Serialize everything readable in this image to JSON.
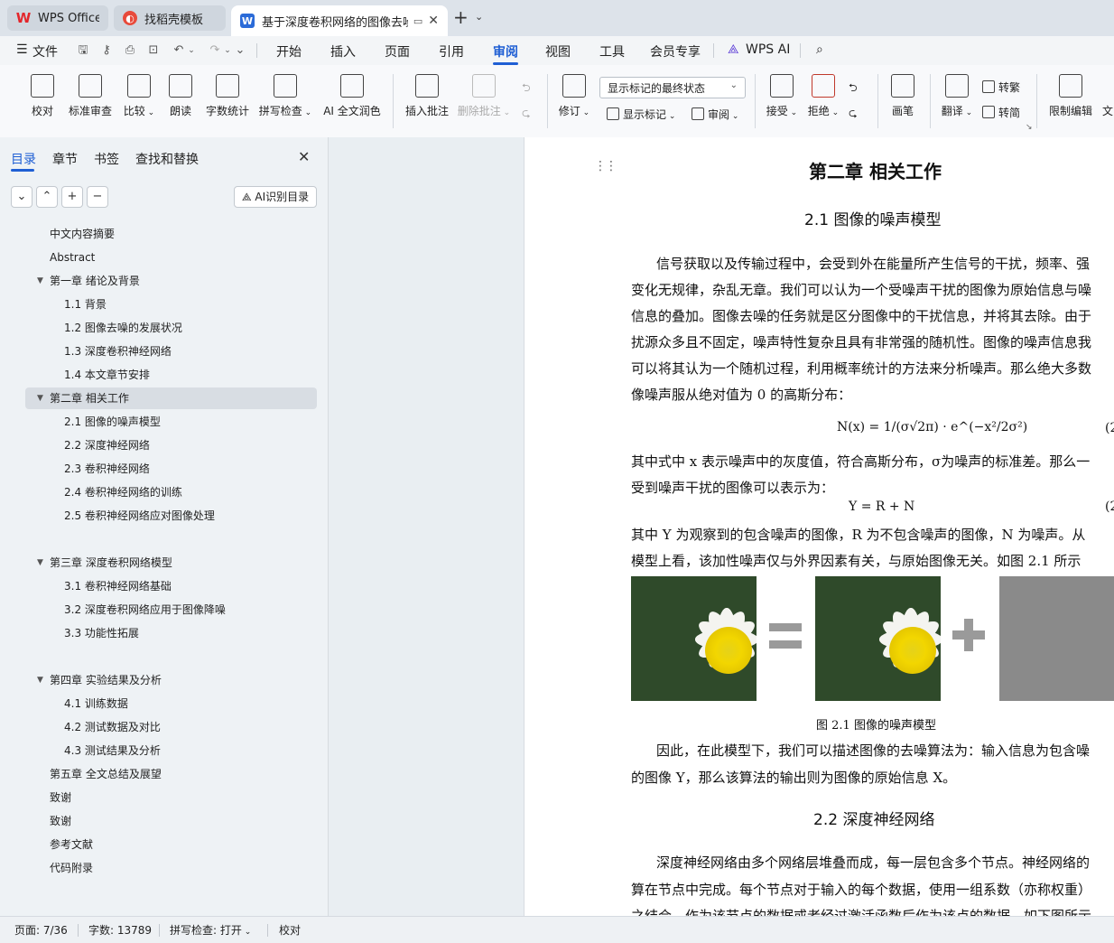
{
  "titlebar": {
    "tabs": [
      {
        "label": "WPS Office"
      },
      {
        "label": "找稻壳模板"
      },
      {
        "label": "基于深度卷积网络的图像去噪"
      }
    ]
  },
  "menu": {
    "file": "文件",
    "items": [
      "开始",
      "插入",
      "页面",
      "引用",
      "审阅",
      "视图",
      "工具",
      "会员专享"
    ],
    "active": "审阅",
    "wps_ai": "WPS AI"
  },
  "ribbon": {
    "buttons": [
      "校对",
      "标准审查",
      "比较",
      "朗读",
      "字数统计",
      "拼写检查",
      "AI 全文润色",
      "插入批注",
      "删除批注",
      "修订",
      "接受",
      "拒绝",
      "画笔",
      "限制编辑",
      "文"
    ],
    "display_dropdown": "显示标记的最终状态",
    "show_markup": "显示标记",
    "review": "审阅",
    "translate": "翻译",
    "to_traditional": "转繁",
    "to_simplified": "转简"
  },
  "nav": {
    "tabs": [
      "目录",
      "章节",
      "书签",
      "查找和替换"
    ],
    "ai_button": "AI识别目录",
    "toc": [
      {
        "label": "中文内容摘要"
      },
      {
        "label": "Abstract"
      },
      {
        "label": "第一章  绪论及背景"
      },
      {
        "label": "1.1 背景"
      },
      {
        "label": "1.2  图像去噪的发展状况"
      },
      {
        "label": "1.3  深度卷积神经网络"
      },
      {
        "label": "1.4  本文章节安排"
      },
      {
        "label": "第二章  相关工作"
      },
      {
        "label": "2.1 图像的噪声模型"
      },
      {
        "label": "2.2 深度神经网络"
      },
      {
        "label": "2.3 卷积神经网络"
      },
      {
        "label": "2.4  卷积神经网络的训练"
      },
      {
        "label": "2.5  卷积神经网络应对图像处理"
      },
      {
        "label": "第三章  深度卷积网络模型"
      },
      {
        "label": "3.1  卷积神经网络基础"
      },
      {
        "label": "3.2  深度卷积网络应用于图像降噪"
      },
      {
        "label": "3.3  功能性拓展"
      },
      {
        "label": "第四章  实验结果及分析"
      },
      {
        "label": "4.1  训练数据"
      },
      {
        "label": "4.2  测试数据及对比"
      },
      {
        "label": "4.3  测试结果及分析"
      },
      {
        "label": "第五章  全文总结及展望"
      },
      {
        "label": "致谢"
      },
      {
        "label": "致谢"
      },
      {
        "label": "参考文献"
      },
      {
        "label": "代码附录"
      }
    ]
  },
  "document": {
    "chapter_title": "第二章  相关工作",
    "section_21": "2.1 图像的噪声模型",
    "para1": [
      "信号获取以及传输过程中，会受到外在能量所产生信号的干扰，频率、强",
      "变化无规律，杂乱无章。我们可以认为一个受噪声干扰的图像为原始信息与噪",
      "信息的叠加。图像去噪的任务就是区分图像中的干扰信息，并将其去除。由于",
      "扰源众多且不固定，噪声特性复杂且具有非常强的随机性。图像的噪声信息我",
      "可以将其认为一个随机过程，利用概率统计的方法来分析噪声。那么绝大多数",
      "像噪声服从绝对值为 0 的高斯分布："
    ],
    "formula1": "N(x) = 1/(σ√2π) · e^(−x²/2σ²)",
    "eq1_no": "(2",
    "para2": [
      "其中式中 x 表示噪声中的灰度值，符合高斯分布，σ为噪声的标准差。那么一",
      "受到噪声干扰的图像可以表示为："
    ],
    "formula2": "Y = R + N",
    "eq2_no": "(2",
    "para3": [
      "其中 Y 为观察到的包含噪声的图像，R 为不包含噪声的图像，N 为噪声。从",
      "模型上看，该加性噪声仅与外界因素有关，与原始图像无关。如图 2.1 所示"
    ],
    "figure_caption": "图 2.1  图像的噪声模型",
    "para4": [
      "因此，在此模型下，我们可以描述图像的去噪算法为：输入信息为包含噪",
      "的图像 Y，那么该算法的输出则为图像的原始信息 X。"
    ],
    "section_22": "2.2 深度神经网络",
    "para5": [
      "深度神经网络由多个网络层堆叠而成，每一层包含多个节点。神经网络的",
      "算在节点中完成。每个节点对于输入的每个数据，使用一组系数（亦称权重）",
      "之结合，作为该节点的数据或者经过激活函数后作为该点的数据。如下图所示"
    ]
  },
  "status": {
    "page": "页面: 7/36",
    "words": "字数: 13789",
    "spell": "拼写检查: 打开",
    "proof": "校对"
  }
}
